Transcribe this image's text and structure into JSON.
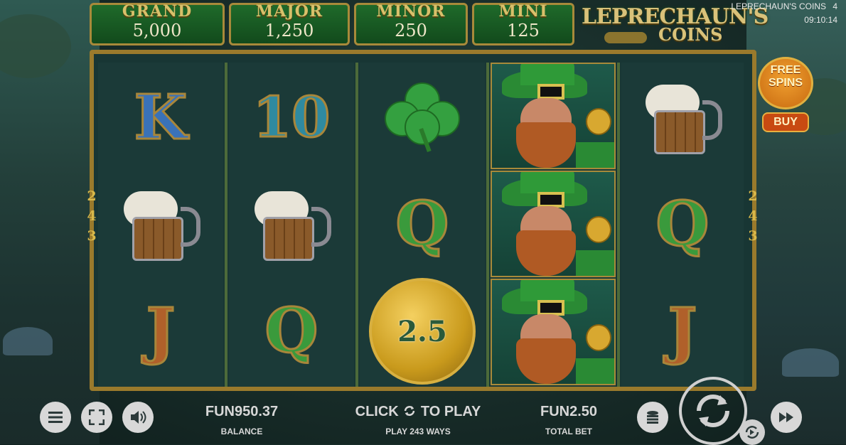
{
  "jackpots": [
    {
      "label": "GRAND",
      "value": "5,000"
    },
    {
      "label": "MAJOR",
      "value": "1,250"
    },
    {
      "label": "MINOR",
      "value": "250"
    },
    {
      "label": "MINI",
      "value": "125"
    }
  ],
  "logo": {
    "line1": "LEPRECHAUN'S",
    "line2": "COINS"
  },
  "header": {
    "game_title": "LEPRECHAUN'S COINS",
    "count": "4",
    "clock": "09:10:14"
  },
  "ways": {
    "left": [
      "2",
      "4",
      "3"
    ],
    "right": [
      "2",
      "4",
      "3"
    ]
  },
  "reels": [
    [
      "K",
      "mug",
      "J"
    ],
    [
      "10",
      "mug",
      "Q"
    ],
    [
      "clover",
      "Q",
      "coin"
    ],
    [
      "leprechaun",
      "leprechaun",
      "leprechaun"
    ],
    [
      "mug",
      "Q",
      "J"
    ]
  ],
  "coin_value": "2.5",
  "free_spins": {
    "line1": "FREE",
    "line2": "SPINS",
    "buy_label": "BUY"
  },
  "bottom": {
    "balance_value": "FUN950.37",
    "balance_label": "BALANCE",
    "click_prefix": "CLICK",
    "click_suffix": "TO PLAY",
    "ways_label": "PLAY 243 WAYS",
    "bet_value": "FUN2.50",
    "bet_label": "TOTAL BET"
  },
  "icons": {
    "menu": "menu-icon",
    "fullscreen": "fullscreen-icon",
    "sound": "sound-icon",
    "coins": "coin-stack-icon",
    "spin": "spin-icon",
    "autoplay": "autoplay-icon",
    "turbo": "fast-forward-icon"
  },
  "colors": {
    "frame_gold": "#9a7a2c",
    "jackpot_green": "#1f6a2a",
    "buy_orange": "#c84a12"
  }
}
